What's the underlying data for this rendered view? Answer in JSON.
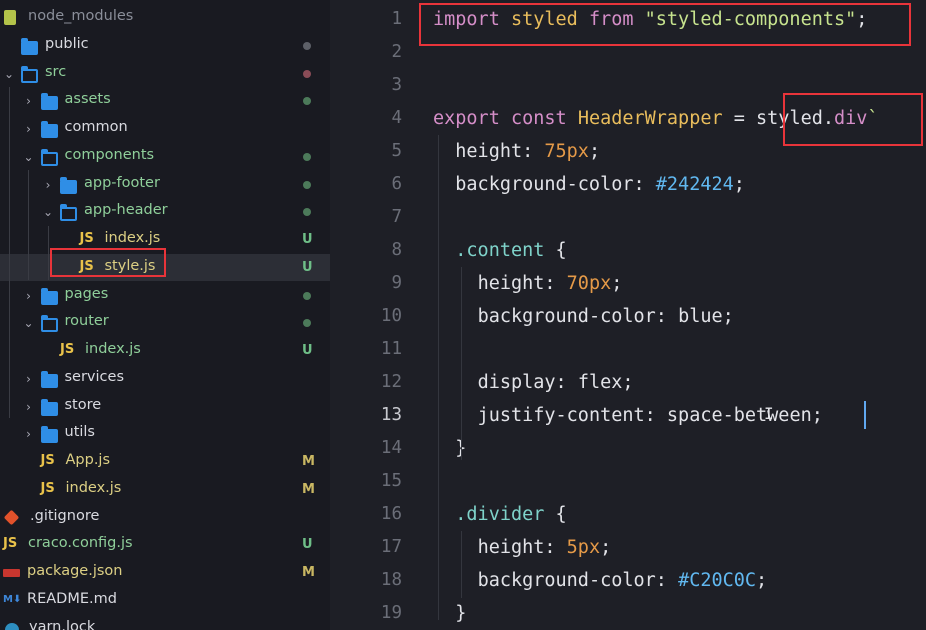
{
  "explorer": [
    {
      "name": "node_modules",
      "icon": "node-modules-folder-icon",
      "dim": true,
      "indent": 0
    },
    {
      "name": "public",
      "icon": "folder-icon",
      "chev": "",
      "indent": 0,
      "status": "dot"
    },
    {
      "name": "src",
      "icon": "folder-open-icon",
      "chev": "⌄",
      "indent": 0,
      "status": "dot-red",
      "color": "green"
    },
    {
      "name": "assets",
      "icon": "folder-icon",
      "chev": "›",
      "indent": 1,
      "status": "dot-green",
      "color": "green"
    },
    {
      "name": "common",
      "icon": "folder-icon",
      "chev": "›",
      "indent": 1,
      "status": ""
    },
    {
      "name": "components",
      "icon": "folder-open-icon",
      "chev": "⌄",
      "indent": 1,
      "status": "dot-green",
      "color": "green"
    },
    {
      "name": "app-footer",
      "icon": "folder-icon",
      "chev": "›",
      "indent": 2,
      "status": "dot-green",
      "color": "green"
    },
    {
      "name": "app-header",
      "icon": "folder-open-icon",
      "chev": "⌄",
      "indent": 2,
      "status": "dot-green",
      "color": "green"
    },
    {
      "name": "index.js",
      "icon": "js-file-icon",
      "indent": 3,
      "status": "U",
      "color": "yellow"
    },
    {
      "name": "style.js",
      "icon": "js-file-icon",
      "indent": 3,
      "status": "U",
      "color": "yellow",
      "selected": true
    },
    {
      "name": "pages",
      "icon": "folder-icon",
      "chev": "›",
      "indent": 1,
      "status": "dot-green",
      "color": "green"
    },
    {
      "name": "router",
      "icon": "folder-open-icon",
      "chev": "⌄",
      "indent": 1,
      "status": "dot-green",
      "color": "green"
    },
    {
      "name": "index.js",
      "icon": "js-file-icon",
      "indent": 2,
      "status": "U",
      "color": "green"
    },
    {
      "name": "services",
      "icon": "folder-icon",
      "chev": "›",
      "indent": 1,
      "status": ""
    },
    {
      "name": "store",
      "icon": "folder-icon",
      "chev": "›",
      "indent": 1,
      "status": ""
    },
    {
      "name": "utils",
      "icon": "folder-icon",
      "chev": "›",
      "indent": 1,
      "status": ""
    },
    {
      "name": "App.js",
      "icon": "js-file-icon",
      "indent": 1,
      "status": "M",
      "color": "yellow"
    },
    {
      "name": "index.js",
      "icon": "js-file-icon",
      "indent": 1,
      "status": "M",
      "color": "yellow"
    },
    {
      "name": ".gitignore",
      "icon": "git-icon",
      "indent": 0,
      "status": ""
    },
    {
      "name": "craco.config.js",
      "icon": "js-file-icon",
      "indent": 0,
      "status": "U",
      "color": "green"
    },
    {
      "name": "package.json",
      "icon": "package-icon",
      "indent": 0,
      "status": "M",
      "color": "yellow"
    },
    {
      "name": "README.md",
      "icon": "markdown-icon",
      "indent": 0,
      "status": ""
    },
    {
      "name": "yarn.lock",
      "icon": "yarn-icon",
      "indent": 0,
      "status": ""
    }
  ],
  "editor": {
    "lines": [
      {
        "n": "1",
        "tokens": [
          [
            "kw",
            "import"
          ],
          [
            "pl",
            " "
          ],
          [
            "cls",
            "styled"
          ],
          [
            "pl",
            " "
          ],
          [
            "kw",
            "from"
          ],
          [
            "pl",
            " "
          ],
          [
            "str",
            "\"styled-components\""
          ],
          [
            "pun",
            ";"
          ]
        ]
      },
      {
        "n": "2",
        "tokens": []
      },
      {
        "n": "3",
        "tokens": []
      },
      {
        "n": "4",
        "tokens": [
          [
            "kw",
            "export"
          ],
          [
            "pl",
            " "
          ],
          [
            "kw",
            "const"
          ],
          [
            "pl",
            " "
          ],
          [
            "cls",
            "HeaderWrapper"
          ],
          [
            "pl",
            " "
          ],
          [
            "pun",
            "="
          ],
          [
            "pl",
            " "
          ],
          [
            "obj",
            "styled"
          ],
          [
            "pun",
            "."
          ],
          [
            "meth",
            "div"
          ],
          [
            "str",
            "`"
          ]
        ]
      },
      {
        "n": "5",
        "tokens": [
          [
            "pl",
            "  "
          ],
          [
            "prop",
            "height"
          ],
          [
            "pun",
            ": "
          ],
          [
            "num",
            "75px"
          ],
          [
            "pun",
            ";"
          ]
        ]
      },
      {
        "n": "6",
        "tokens": [
          [
            "pl",
            "  "
          ],
          [
            "prop",
            "background-color"
          ],
          [
            "pun",
            ": "
          ],
          [
            "hex",
            "#242424"
          ],
          [
            "pun",
            ";"
          ]
        ]
      },
      {
        "n": "7",
        "tokens": []
      },
      {
        "n": "8",
        "tokens": [
          [
            "pl",
            "  "
          ],
          [
            "sel",
            ".content"
          ],
          [
            "pl",
            " "
          ],
          [
            "pun",
            "{"
          ]
        ]
      },
      {
        "n": "9",
        "tokens": [
          [
            "pl",
            "    "
          ],
          [
            "prop",
            "height"
          ],
          [
            "pun",
            ": "
          ],
          [
            "num",
            "70px"
          ],
          [
            "pun",
            ";"
          ]
        ]
      },
      {
        "n": "10",
        "tokens": [
          [
            "pl",
            "    "
          ],
          [
            "prop",
            "background-color"
          ],
          [
            "pun",
            ": "
          ],
          [
            "pl",
            "blue"
          ],
          [
            "pun",
            ";"
          ]
        ]
      },
      {
        "n": "11",
        "tokens": []
      },
      {
        "n": "12",
        "tokens": [
          [
            "pl",
            "    "
          ],
          [
            "prop",
            "display"
          ],
          [
            "pun",
            ": "
          ],
          [
            "pl",
            "flex"
          ],
          [
            "pun",
            ";"
          ]
        ]
      },
      {
        "n": "13",
        "tokens": [
          [
            "pl",
            "    "
          ],
          [
            "prop",
            "justify-content"
          ],
          [
            "pun",
            ": "
          ],
          [
            "pl",
            "space-between"
          ],
          [
            "pun",
            ";"
          ]
        ],
        "active": true
      },
      {
        "n": "14",
        "tokens": [
          [
            "pl",
            "  "
          ],
          [
            "pun",
            "}"
          ]
        ]
      },
      {
        "n": "15",
        "tokens": []
      },
      {
        "n": "16",
        "tokens": [
          [
            "pl",
            "  "
          ],
          [
            "sel",
            ".divider"
          ],
          [
            "pl",
            " "
          ],
          [
            "pun",
            "{"
          ]
        ]
      },
      {
        "n": "17",
        "tokens": [
          [
            "pl",
            "    "
          ],
          [
            "prop",
            "height"
          ],
          [
            "pun",
            ": "
          ],
          [
            "num",
            "5px"
          ],
          [
            "pun",
            ";"
          ]
        ]
      },
      {
        "n": "18",
        "tokens": [
          [
            "pl",
            "    "
          ],
          [
            "prop",
            "background-color"
          ],
          [
            "pun",
            ": "
          ],
          [
            "hex",
            "#C20C0C"
          ],
          [
            "pun",
            ";"
          ]
        ]
      },
      {
        "n": "19",
        "tokens": [
          [
            "pl",
            "  "
          ],
          [
            "pun",
            "}"
          ]
        ]
      }
    ]
  }
}
